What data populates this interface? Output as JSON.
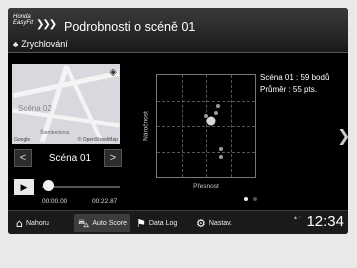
{
  "header": {
    "logo_line1": "Honda",
    "logo_line2": "EasyFit",
    "title": "Podrobnosti o scéně 01",
    "section": "Zrychlování"
  },
  "map": {
    "label_main": "Scéna 02",
    "label_street": "Štemberkova",
    "attribution": "© OpenStreetMap",
    "google": "Google"
  },
  "scene_nav": {
    "prev": "<",
    "label": "Scéna 01",
    "next": ">"
  },
  "player": {
    "play": "▶",
    "progress": 0.02,
    "time_start": "00:00.00",
    "time_end": "00:22.87"
  },
  "chart_data": {
    "type": "scatter",
    "xlabel": "Přesnost",
    "ylabel": "Náročnost",
    "xlim": [
      0,
      4
    ],
    "ylim": [
      0,
      4
    ],
    "grid": true,
    "points": [
      {
        "x": 2.2,
        "y": 2.2,
        "size": "large"
      },
      {
        "x": 2.5,
        "y": 2.8,
        "size": "small"
      },
      {
        "x": 2.4,
        "y": 2.5,
        "size": "small"
      },
      {
        "x": 2.0,
        "y": 2.4,
        "size": "small"
      },
      {
        "x": 2.6,
        "y": 1.1,
        "size": "small"
      },
      {
        "x": 2.6,
        "y": 0.8,
        "size": "small"
      }
    ]
  },
  "score": {
    "scene_line": "Scéna 01 : 59 bodů",
    "avg_line": "Průměr : 55 pts."
  },
  "pager": {
    "pages": 2,
    "active": 0
  },
  "tabs": [
    {
      "icon": "home-icon",
      "label": "Nahoru",
      "active": false
    },
    {
      "icon": "car-icon",
      "label": "Auto Score",
      "active": true
    },
    {
      "icon": "flag-icon",
      "label": "Data Log",
      "active": false
    },
    {
      "icon": "gear-icon",
      "label": "Nastav.",
      "active": false
    }
  ],
  "status": {
    "clock": "12:34"
  }
}
